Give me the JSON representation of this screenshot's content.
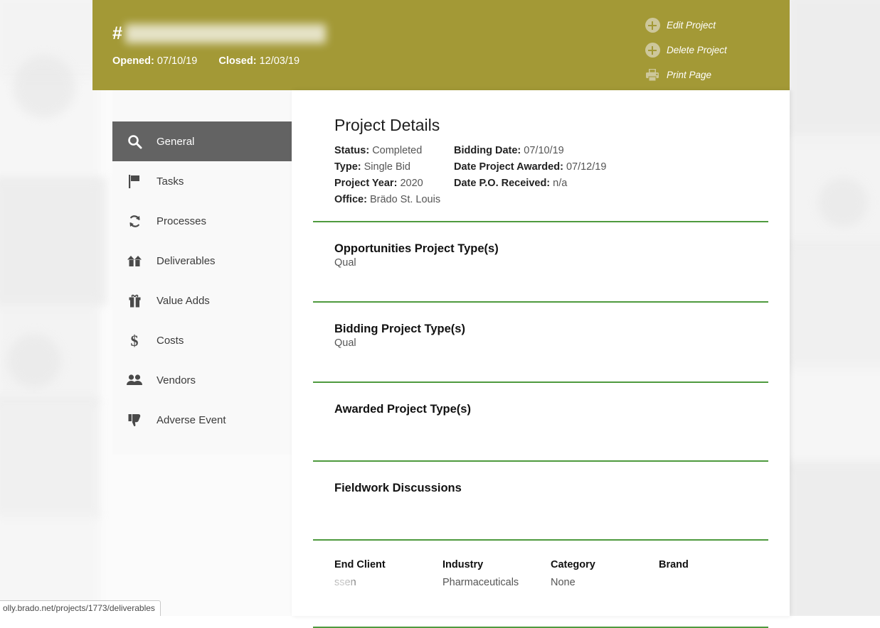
{
  "header": {
    "hash_symbol": "#",
    "project_title_redacted": true,
    "opened_label": "Opened:",
    "opened_value": "07/10/19",
    "closed_label": "Closed:",
    "closed_value": "12/03/19",
    "actions": [
      {
        "label": "Edit Project",
        "icon": "circle-plus-icon"
      },
      {
        "label": "Delete Project",
        "icon": "circle-plus-icon"
      },
      {
        "label": "Print Page",
        "icon": "printer-icon"
      }
    ]
  },
  "sidebar": {
    "items": [
      {
        "label": "General",
        "icon": "search-icon",
        "active": true
      },
      {
        "label": "Tasks",
        "icon": "flag-icon",
        "active": false
      },
      {
        "label": "Processes",
        "icon": "refresh-icon",
        "active": false
      },
      {
        "label": "Deliverables",
        "icon": "open-box-icon",
        "active": false
      },
      {
        "label": "Value Adds",
        "icon": "gift-icon",
        "active": false
      },
      {
        "label": "Costs",
        "icon": "dollar-icon",
        "active": false
      },
      {
        "label": "Vendors",
        "icon": "people-icon",
        "active": false
      },
      {
        "label": "Adverse Event",
        "icon": "thumbs-down-icon",
        "active": false
      }
    ]
  },
  "details": {
    "title": "Project Details",
    "fields": [
      {
        "label": "Status:",
        "value": "Completed"
      },
      {
        "label": "Bidding Date:",
        "value": "07/10/19"
      },
      {
        "label": "Type:",
        "value": "Single Bid"
      },
      {
        "label": "Date Project Awarded:",
        "value": "07/12/19"
      },
      {
        "label": "Project Year:",
        "value": "2020"
      },
      {
        "label": "Date P.O. Received:",
        "value": "n/a"
      },
      {
        "label": "Office:",
        "value": "Brädo St. Louis"
      },
      {
        "label": "",
        "value": ""
      }
    ]
  },
  "sections": [
    {
      "heading": "Opportunities Project Type(s)",
      "body": "Qual"
    },
    {
      "heading": "Bidding Project Type(s)",
      "body": "Qual"
    },
    {
      "heading": "Awarded Project Type(s)",
      "body": ""
    },
    {
      "heading": "Fieldwork Discussions",
      "body": ""
    }
  ],
  "client_table": {
    "columns": [
      "End Client",
      "Industry",
      "Category",
      "Brand"
    ],
    "row": {
      "end_client": "ssen",
      "industry": "Pharmaceuticals",
      "category": "None",
      "brand": ""
    }
  },
  "status_bar": {
    "url": "olly.brado.net/projects/1773/deliverables"
  },
  "colors": {
    "header_gold": "#a39936",
    "sidebar_active": "#636363",
    "divider_green": "#4e9a3e",
    "sidebar_bg": "#f9f9f9"
  }
}
